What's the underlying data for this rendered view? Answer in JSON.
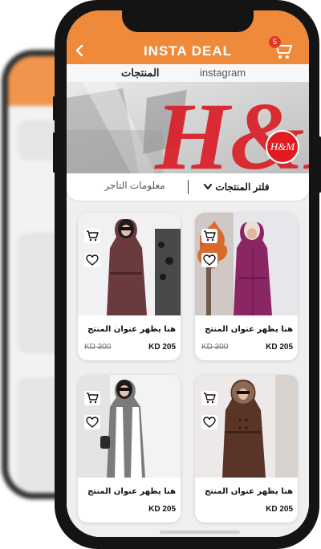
{
  "header": {
    "title": "INSTA DEAL",
    "cart_count": "5",
    "accent": "#ef8a3b"
  },
  "tabs": {
    "products": "المنتجات",
    "instagram": "instagram"
  },
  "banner": {
    "logo_text": "H&M"
  },
  "filter": {
    "filter_label": "فلتر المنتجات",
    "merchant_label": "معلومات التاجر"
  },
  "products": [
    {
      "title": "هنا يظهر عنوان المنتج",
      "price": "KD 205",
      "old_price": "KD 300"
    },
    {
      "title": "هنا يظهر عنوان المنتج",
      "price": "KD 205",
      "old_price": "KD 300"
    },
    {
      "title": "هنا يظهر عنوان المنتج",
      "price": "KD 205"
    },
    {
      "title": "هنا يظهر عنوان المنتج",
      "price": "KD 205"
    }
  ],
  "icons": [
    "back-arrow-icon",
    "cart-icon",
    "chevron-down-icon",
    "heart-icon"
  ]
}
